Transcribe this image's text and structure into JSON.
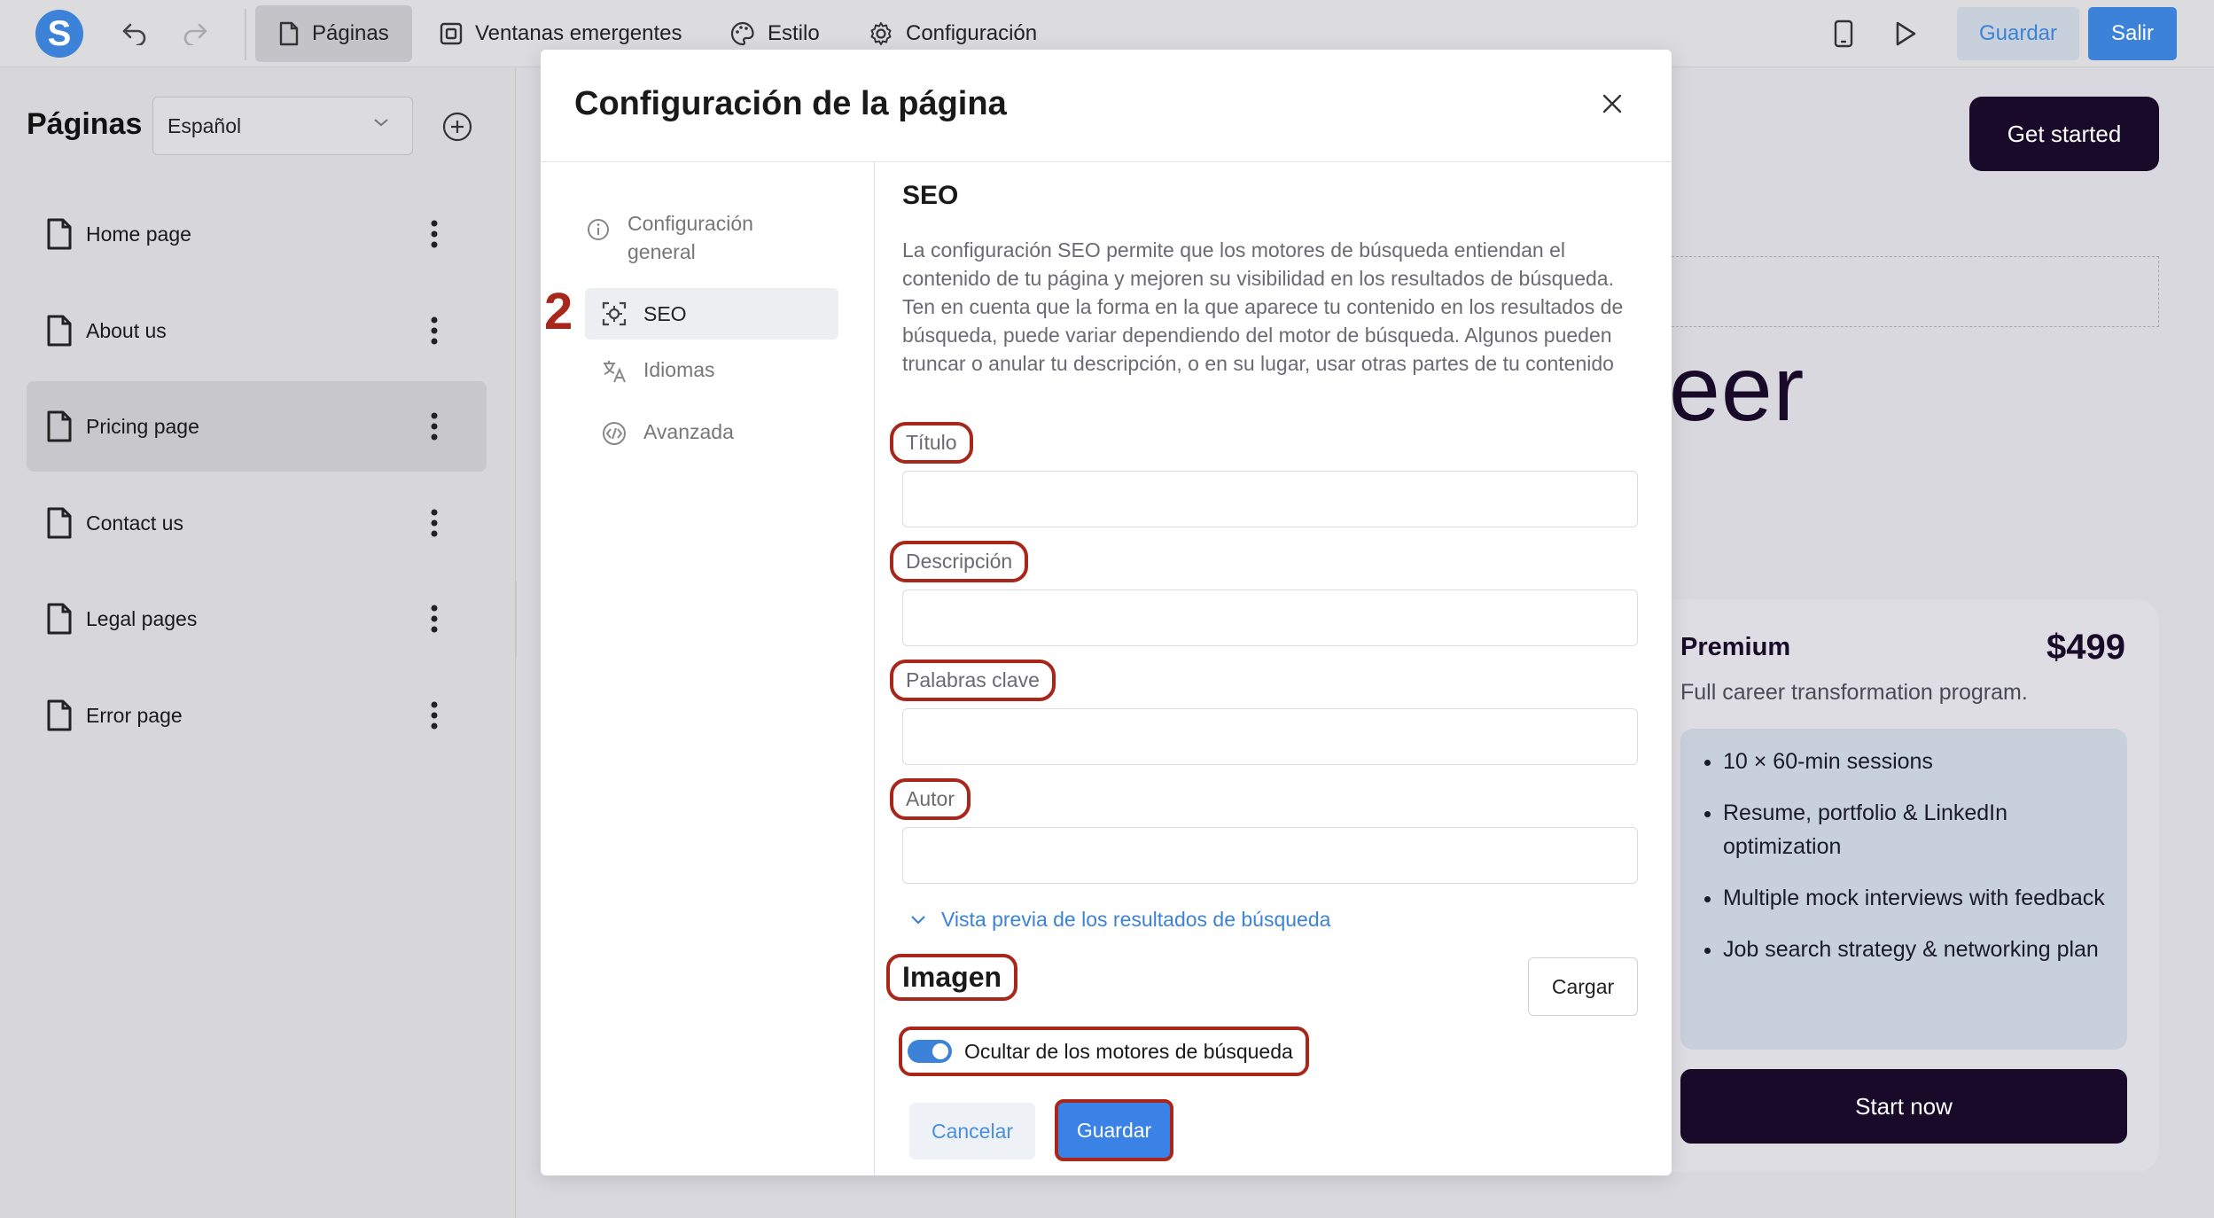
{
  "topbar": {
    "logo_letter": "S",
    "tabs": [
      {
        "label": "Páginas",
        "icon": "page-icon",
        "active": true
      },
      {
        "label": "Ventanas emergentes",
        "icon": "popup-icon",
        "active": false
      },
      {
        "label": "Estilo",
        "icon": "palette-icon",
        "active": false
      },
      {
        "label": "Configuración",
        "icon": "gear-icon",
        "active": false
      }
    ],
    "guardar_label": "Guardar",
    "salir_label": "Salir"
  },
  "sidebar": {
    "title": "Páginas",
    "language": "Español",
    "pages": [
      {
        "label": "Home page",
        "active": false
      },
      {
        "label": "About us",
        "active": false
      },
      {
        "label": "Pricing page",
        "active": true
      },
      {
        "label": "Contact us",
        "active": false
      },
      {
        "label": "Legal pages",
        "active": false
      },
      {
        "label": "Error page",
        "active": false
      }
    ]
  },
  "canvas": {
    "get_started": "Get started",
    "heading_fragment": "eer",
    "plan": {
      "name": "Premium",
      "price": "$499",
      "description": "Full career transformation program.",
      "features": [
        "10 × 60-min sessions",
        "Resume, portfolio & LinkedIn optimization",
        "Multiple mock interviews with feedback",
        "Job search strategy & networking plan"
      ],
      "cta": "Start now"
    }
  },
  "modal": {
    "title": "Configuración de la página",
    "step_badge": "2",
    "nav": [
      {
        "label": "Configuración general",
        "icon": "info-icon",
        "active": false
      },
      {
        "label": "SEO",
        "icon": "seo-icon",
        "active": true
      },
      {
        "label": "Idiomas",
        "icon": "translate-icon",
        "active": false
      },
      {
        "label": "Avanzada",
        "icon": "code-icon",
        "active": false
      }
    ],
    "seo": {
      "title": "SEO",
      "description": "La configuración SEO permite que los motores de búsqueda entiendan el contenido de tu página y mejoren su visibilidad en los resultados de búsqueda. Ten en cuenta que la forma en la que aparece tu contenido en los resultados de búsqueda, puede variar dependiendo del motor de búsqueda. Algunos pueden truncar o anular tu descripción, o en su lugar, usar otras partes de tu contenido",
      "fields": [
        {
          "label": "Título",
          "value": ""
        },
        {
          "label": "Descripción",
          "value": ""
        },
        {
          "label": "Palabras clave",
          "value": ""
        },
        {
          "label": "Autor",
          "value": ""
        }
      ],
      "preview_link": "Vista previa de los resultados de búsqueda",
      "image_label": "Imagen",
      "upload_label": "Cargar",
      "hide_toggle_label": "Ocultar de los motores de búsqueda",
      "hide_toggle_on": true
    },
    "cancel_label": "Cancelar",
    "save_label": "Guardar"
  },
  "colors": {
    "accent": "#3b82d8",
    "annotation": "#a8261a",
    "dark_brand": "#1a0a2a"
  }
}
